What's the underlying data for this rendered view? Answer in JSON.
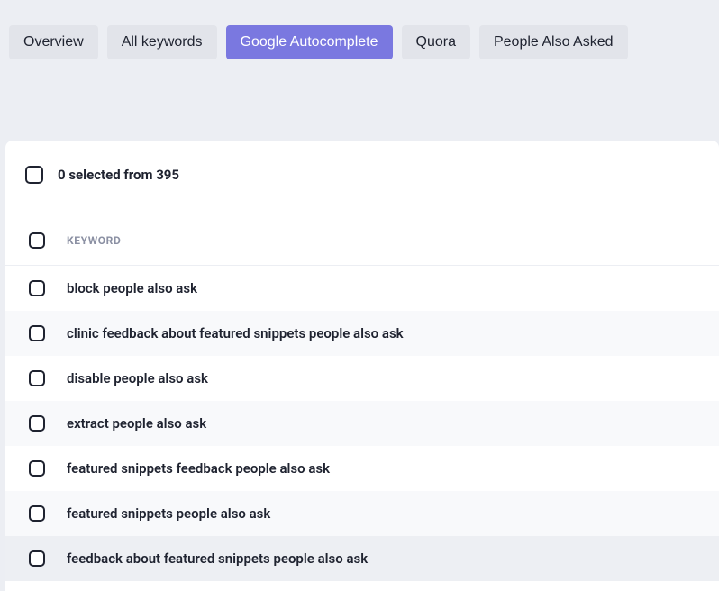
{
  "tabs": [
    {
      "label": "Overview",
      "active": false
    },
    {
      "label": "All keywords",
      "active": false
    },
    {
      "label": "Google Autocomplete",
      "active": true
    },
    {
      "label": "Quora",
      "active": false
    },
    {
      "label": "People Also Asked",
      "active": false
    }
  ],
  "selection": {
    "text": "0 selected from 395"
  },
  "table": {
    "header": "KEYWORD",
    "rows": [
      {
        "keyword": "block people also ask"
      },
      {
        "keyword": "clinic feedback about featured snippets people also ask"
      },
      {
        "keyword": "disable people also ask"
      },
      {
        "keyword": "extract people also ask"
      },
      {
        "keyword": "featured snippets feedback people also ask"
      },
      {
        "keyword": "featured snippets people also ask"
      },
      {
        "keyword": "feedback about featured snippets people also ask"
      }
    ]
  }
}
